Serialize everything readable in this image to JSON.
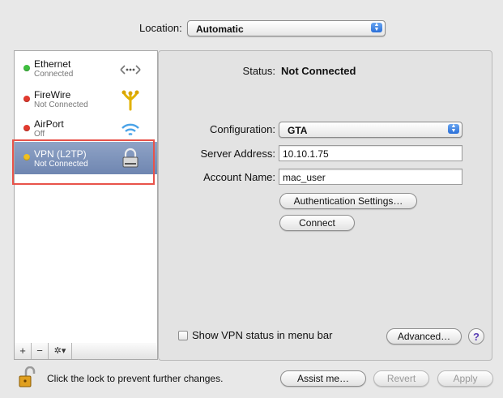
{
  "location": {
    "label": "Location:",
    "value": "Automatic"
  },
  "services": [
    {
      "name": "Ethernet",
      "status": "Connected",
      "dot_color": "#3fbf3f",
      "icon": "ethernet-icon"
    },
    {
      "name": "FireWire",
      "status": "Not Connected",
      "dot_color": "#e23a2e",
      "icon": "firewire-icon"
    },
    {
      "name": "AirPort",
      "status": "Off",
      "dot_color": "#e23a2e",
      "icon": "airport-wifi-icon"
    },
    {
      "name": "VPN (L2TP)",
      "status": "Not Connected",
      "dot_color": "#f0c020",
      "icon": "lock-icon",
      "selected": true
    }
  ],
  "sidebar_tools": {
    "add": "+",
    "remove": "−",
    "gear": "✲▾"
  },
  "detail": {
    "status_label": "Status:",
    "status_value": "Not Connected",
    "configuration_label": "Configuration:",
    "configuration_value": "GTA",
    "server_label": "Server Address:",
    "server_value": "10.10.1.75",
    "account_label": "Account Name:",
    "account_value": "mac_user",
    "auth_button": "Authentication Settings…",
    "connect_button": "Connect",
    "show_vpn_label": "Show VPN status in menu bar",
    "show_vpn_checked": false,
    "advanced_button": "Advanced…",
    "help": "?"
  },
  "footer": {
    "lock_text": "Click the lock to prevent further changes.",
    "assist_button": "Assist me…",
    "revert_button": "Revert",
    "apply_button": "Apply"
  }
}
